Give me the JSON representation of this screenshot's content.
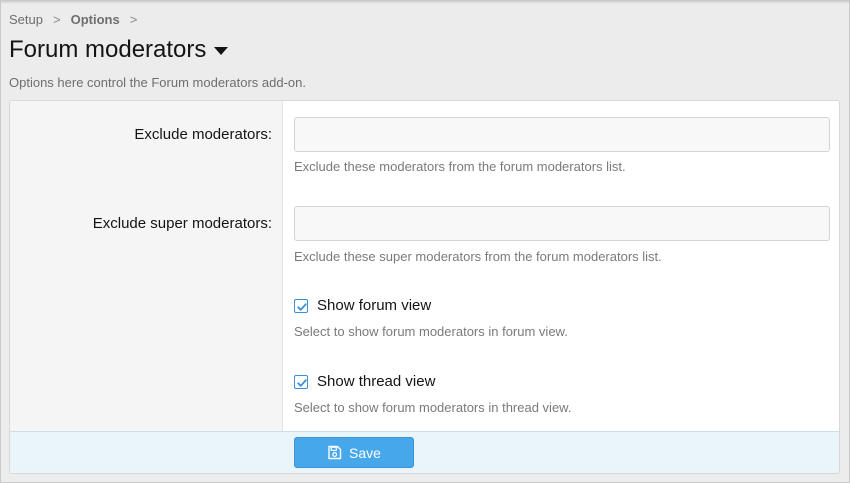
{
  "breadcrumb": {
    "items": [
      "Setup",
      "Options"
    ],
    "separator": ">"
  },
  "header": {
    "title": "Forum moderators",
    "description": "Options here control the Forum moderators add-on."
  },
  "options": {
    "exclude_moderators": {
      "label": "Exclude moderators:",
      "value": "",
      "hint": "Exclude these moderators from the forum moderators list."
    },
    "exclude_super_moderators": {
      "label": "Exclude super moderators:",
      "value": "",
      "hint": "Exclude these super moderators from the forum moderators list."
    },
    "show_forum_view": {
      "label": "Show forum view",
      "checked": true,
      "hint": "Select to show forum moderators in forum view."
    },
    "show_thread_view": {
      "label": "Show thread view",
      "checked": true,
      "hint": "Select to show forum moderators in thread view."
    }
  },
  "footer": {
    "save_label": "Save"
  },
  "colors": {
    "accent": "#47a7eb",
    "footer_bg": "#eaf4fb",
    "checkbox_border": "#3a8fd6"
  },
  "icons": {
    "title_menu": "caret-down-icon",
    "save": "save-icon",
    "check": "check-icon"
  }
}
